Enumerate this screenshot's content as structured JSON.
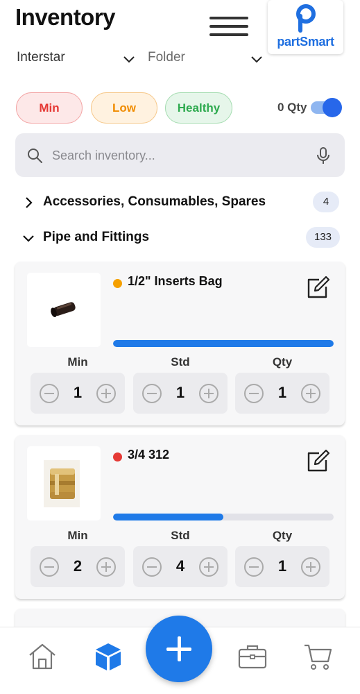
{
  "header": {
    "title": "Inventory",
    "logo_text": "partSmart",
    "brand_color": "#1f6fe0"
  },
  "selectors": {
    "company": "Interstar",
    "folder_placeholder": "Folder"
  },
  "filters": {
    "min_label": "Min",
    "low_label": "Low",
    "healthy_label": "Healthy",
    "zero_qty_label": "0 Qty",
    "zero_qty_enabled": true
  },
  "search": {
    "placeholder": "Search inventory..."
  },
  "categories": [
    {
      "label": "Accessories, Consumables, Spares",
      "count": "4",
      "expanded": false
    },
    {
      "label": "Pipe and Fittings",
      "count": "133",
      "expanded": true
    }
  ],
  "items": [
    {
      "name": "1/2\" Inserts Bag",
      "status_color": "#f5a000",
      "progress": 1.0,
      "min_label": "Min",
      "std_label": "Std",
      "qty_label": "Qty",
      "min": "1",
      "std": "1",
      "qty": "1"
    },
    {
      "name": "3/4 312",
      "status_color": "#e53935",
      "progress": 0.5,
      "min_label": "Min",
      "std_label": "Std",
      "qty_label": "Qty",
      "min": "2",
      "std": "4",
      "qty": "1"
    }
  ],
  "nav": {
    "items": [
      "home-icon",
      "inventory-icon",
      "add-icon",
      "jobs-icon",
      "cart-icon"
    ],
    "active": "inventory-icon",
    "accent_color": "#1f7ae8"
  }
}
